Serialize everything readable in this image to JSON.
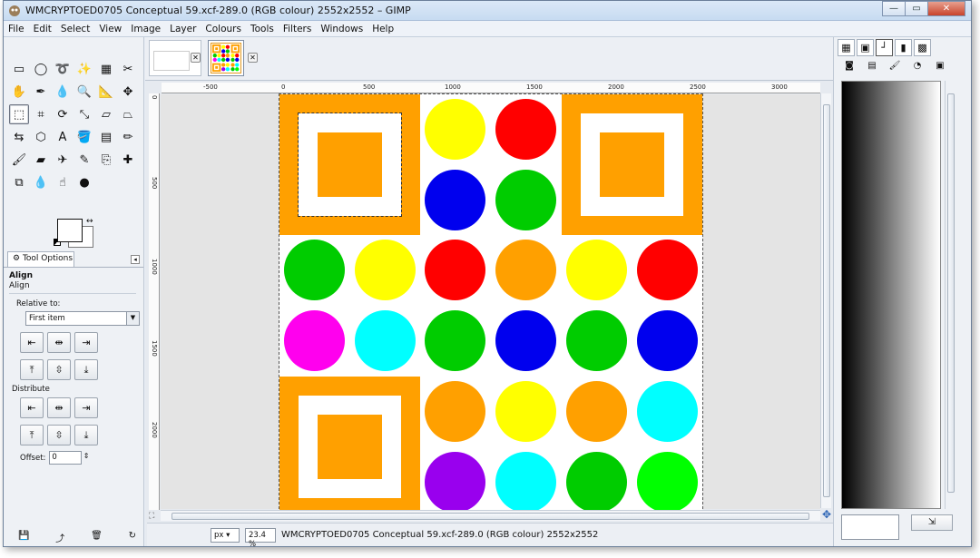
{
  "window": {
    "title": "WMCRYPTOED0705 Conceptual 59.xcf-289.0 (RGB colour) 2552x2552 – GIMP",
    "minimize": "—",
    "maximize": "▭",
    "close": "✕"
  },
  "menubar": [
    "File",
    "Edit",
    "Select",
    "View",
    "Image",
    "Layer",
    "Colours",
    "Tools",
    "Filters",
    "Windows",
    "Help"
  ],
  "toolbox": {
    "tools": [
      {
        "name": "rect-select-icon",
        "glyph": "▭"
      },
      {
        "name": "ellipse-select-icon",
        "glyph": "◯"
      },
      {
        "name": "free-select-icon",
        "glyph": "➰"
      },
      {
        "name": "fuzzy-select-icon",
        "glyph": "✨"
      },
      {
        "name": "select-by-colour-icon",
        "glyph": "▦"
      },
      {
        "name": "scissors-icon",
        "glyph": "✂"
      },
      {
        "name": "foreground-select-icon",
        "glyph": "✋"
      },
      {
        "name": "paths-icon",
        "glyph": "✒"
      },
      {
        "name": "colour-picker-icon",
        "glyph": "💧"
      },
      {
        "name": "zoom-icon",
        "glyph": "🔍"
      },
      {
        "name": "measure-icon",
        "glyph": "📐"
      },
      {
        "name": "move-icon",
        "glyph": "✥"
      },
      {
        "name": "align-icon",
        "glyph": "⬚"
      },
      {
        "name": "crop-icon",
        "glyph": "⌗"
      },
      {
        "name": "rotate-icon",
        "glyph": "⟳"
      },
      {
        "name": "scale-icon",
        "glyph": "⤡"
      },
      {
        "name": "shear-icon",
        "glyph": "▱"
      },
      {
        "name": "perspective-icon",
        "glyph": "⏢"
      },
      {
        "name": "flip-icon",
        "glyph": "⇆"
      },
      {
        "name": "cage-icon",
        "glyph": "⬡"
      },
      {
        "name": "text-icon",
        "glyph": "A"
      },
      {
        "name": "bucket-fill-icon",
        "glyph": "🪣"
      },
      {
        "name": "blend-icon",
        "glyph": "▤"
      },
      {
        "name": "pencil-icon",
        "glyph": "✏"
      },
      {
        "name": "paintbrush-icon",
        "glyph": "🖌"
      },
      {
        "name": "eraser-icon",
        "glyph": "▰"
      },
      {
        "name": "airbrush-icon",
        "glyph": "✈"
      },
      {
        "name": "ink-icon",
        "glyph": "✎"
      },
      {
        "name": "clone-icon",
        "glyph": "⎘"
      },
      {
        "name": "heal-icon",
        "glyph": "✚"
      },
      {
        "name": "perspective-clone-icon",
        "glyph": "⧉"
      },
      {
        "name": "blur-icon",
        "glyph": "💧"
      },
      {
        "name": "smudge-icon",
        "glyph": "☝"
      },
      {
        "name": "dodge-burn-icon",
        "glyph": "●"
      }
    ],
    "active_tool_index": 12,
    "fg_colour": "#ffffff",
    "bg_colour": "#ffffff",
    "swap_glyph": "↔",
    "tool_options": {
      "tab_label": "Tool Options",
      "panel_menu_glyph": "◂",
      "title": "Align",
      "subtitle": "Align",
      "relative_to_label": "Relative to:",
      "relative_to_value": "First item",
      "distribute_label": "Distribute",
      "offset_label": "Offset:",
      "offset_value": "0",
      "align_buttons": [
        "⇤",
        "⇹",
        "⇥",
        "⤒",
        "⇳",
        "⤓"
      ],
      "distribute_buttons": [
        "⇤",
        "⇹",
        "⇥",
        "⤒",
        "⇳",
        "⤓"
      ]
    },
    "bottom_icons": [
      "💾",
      "⤴",
      "🗑",
      "↻"
    ]
  },
  "image_tabs": [
    {
      "name": "image-tab-blank",
      "close": "✕"
    },
    {
      "name": "image-tab-conceptual",
      "close": "✕"
    }
  ],
  "rulers": {
    "top": [
      "-500",
      "0",
      "500",
      "1000",
      "1500",
      "2000",
      "2500",
      "3000"
    ],
    "left": [
      "0",
      "500",
      "1000",
      "1500",
      "2000"
    ]
  },
  "canvas": {
    "orange": "#ffa000",
    "circles": [
      {
        "c": "#ffff00"
      },
      {
        "c": "#ff0000"
      },
      {
        "c": "#0000ee"
      },
      {
        "c": "#00cc00"
      },
      {
        "c": "#00cc00"
      },
      {
        "c": "#ffff00"
      },
      {
        "c": "#ff0000"
      },
      {
        "c": "#ffa000"
      },
      {
        "c": "#ffff00"
      },
      {
        "c": "#ff0000"
      },
      {
        "c": "#ff00ee"
      },
      {
        "c": "#00ffff"
      },
      {
        "c": "#00cc00"
      },
      {
        "c": "#0000ee"
      },
      {
        "c": "#00cc00"
      },
      {
        "c": "#0000ee"
      },
      {
        "c": "#ffa000"
      },
      {
        "c": "#ffff00"
      },
      {
        "c": "#ffa000"
      },
      {
        "c": "#00ffff"
      },
      {
        "c": "#9900ee"
      },
      {
        "c": "#00ffff"
      },
      {
        "c": "#00cc00"
      },
      {
        "c": "#00ff00"
      }
    ]
  },
  "statusbar": {
    "unit": "px",
    "zoom": "23.4 %",
    "text": "WMCRYPTOED0705 Conceptual 59.xcf-289.0 (RGB colour) 2552x2552"
  },
  "dock": {
    "tabs": [
      "▦",
      "▣",
      "┘",
      "▮",
      "▩"
    ],
    "tabs2": [
      "◙",
      "▤",
      "🖌",
      "◔",
      "▣"
    ],
    "button_glyph": "⇲"
  }
}
